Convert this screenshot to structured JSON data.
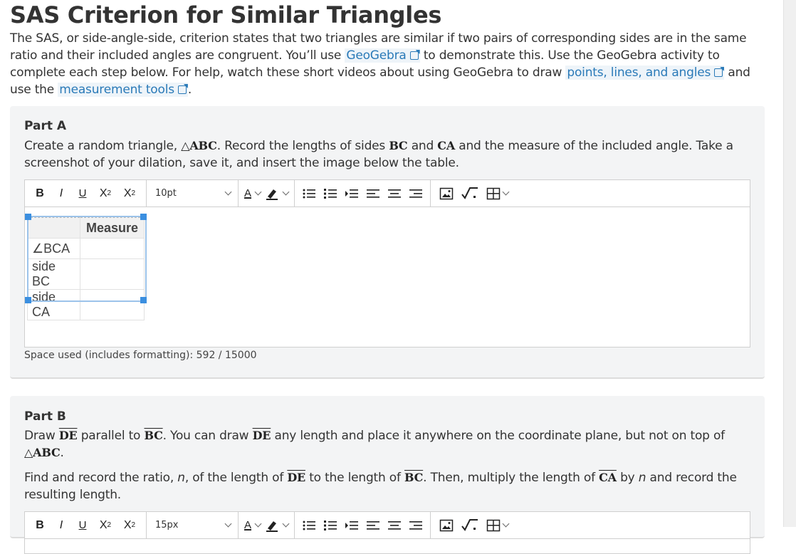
{
  "page": {
    "title": "SAS Criterion for Similar Triangles",
    "intro": {
      "t1": "The SAS, or side-angle-side, criterion states that two triangles are similar if two pairs of corresponding sides are in the same ratio and their included angles are congruent. You’ll use",
      "link1": "GeoGebra",
      "t2": "to demonstrate this. Use the GeoGebra activity to complete each step below. For help, watch these short videos about using GeoGebra to draw",
      "link2": "points, lines, and angles",
      "t3": "and use the",
      "link3": "measurement tools",
      "t4": "."
    }
  },
  "partA": {
    "title": "Part A",
    "p1": "Create a random triangle,",
    "tri": "△ABC",
    "p2": ". Record the lengths of sides",
    "bc": "BC",
    "and": "and",
    "ca": "CA",
    "p3": "and the measure of the included angle. Take a screenshot of your dilation, save it, and insert the image below the table.",
    "editor": {
      "font_size": "10pt",
      "toolbar": {
        "bold": "B",
        "italic": "I",
        "underline": "U",
        "sup": "X",
        "sub": "X",
        "sup_mark": "2",
        "sub_mark": "2",
        "font_color": "A"
      },
      "table": {
        "header": [
          "",
          "Measure"
        ],
        "rows": [
          [
            "∠BCA",
            ""
          ],
          [
            "side BC",
            ""
          ],
          [
            "side CA",
            ""
          ]
        ]
      }
    },
    "counter": "Space used (includes formatting): 592 / 15000"
  },
  "partB": {
    "title": "Part B",
    "p1a": "Draw",
    "de": "DE",
    "p1b": "parallel to",
    "bc": "BC",
    "p1c": ". You can draw",
    "p1d": "any length and place it anywhere on the coordinate plane, but not on top of",
    "tri": "△ABC",
    "dot": ".",
    "p2a": "Find and record the ratio,",
    "n": "n",
    "p2b": ", of the length of",
    "p2c": "to the length of",
    "p2d": ". Then, multiply the length of",
    "ca": "CA",
    "p2e": "by",
    "p2f": "and record the resulting length.",
    "editor": {
      "font_size": "15px"
    }
  },
  "colors": {
    "link": "#2a7ab8",
    "handle": "#3b8fe0",
    "panel": "#f3f4f5"
  },
  "icons": [
    "external-link-icon",
    "text-color-icon",
    "highlight-icon",
    "bullet-list-icon",
    "numbered-list-icon",
    "indent-icon",
    "align-left-icon",
    "align-center-icon",
    "align-right-icon",
    "insert-image-icon",
    "math-icon",
    "table-icon"
  ]
}
